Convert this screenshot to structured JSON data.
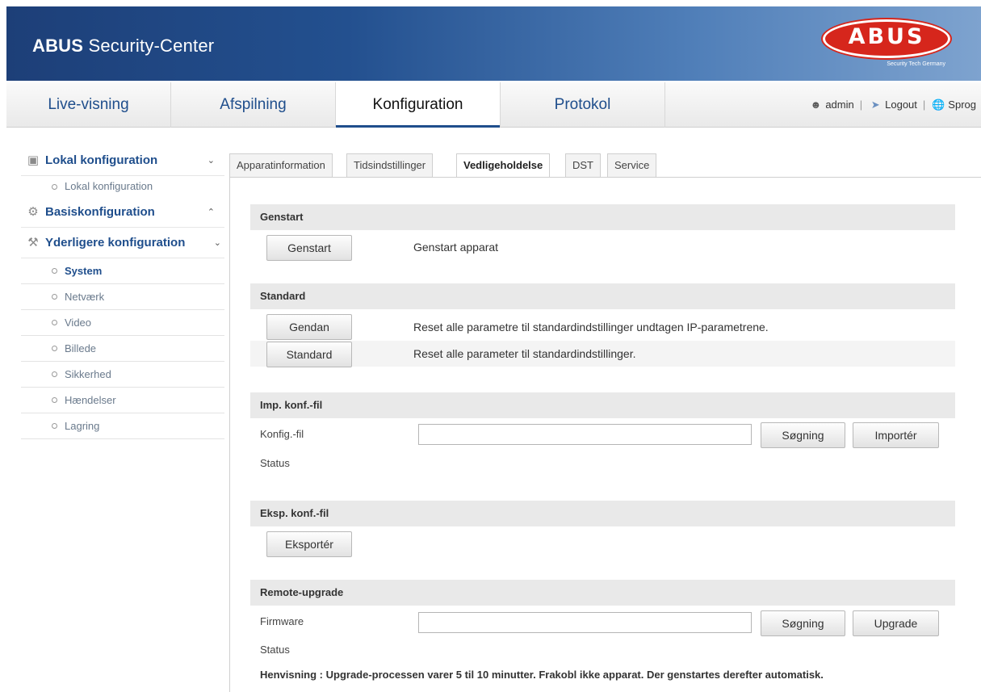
{
  "header": {
    "brand": "ABUS",
    "product": "Security-Center",
    "logo_text": "ABUS",
    "logo_tagline": "Security Tech Germany"
  },
  "nav": {
    "tabs": [
      {
        "label": "Live-visning"
      },
      {
        "label": "Afspilning"
      },
      {
        "label": "Konfiguration",
        "active": true
      },
      {
        "label": "Protokol"
      }
    ],
    "user": "admin",
    "logout": "Logout",
    "language": "Sprog"
  },
  "sidebar": {
    "local": {
      "label": "Lokal konfiguration",
      "items": [
        {
          "label": "Lokal konfiguration"
        }
      ]
    },
    "basic": {
      "label": "Basiskonfiguration"
    },
    "advanced": {
      "label": "Yderligere konfiguration",
      "items": [
        {
          "label": "System",
          "active": true
        },
        {
          "label": "Netværk"
        },
        {
          "label": "Video"
        },
        {
          "label": "Billede"
        },
        {
          "label": "Sikkerhed"
        },
        {
          "label": "Hændelser"
        },
        {
          "label": "Lagring"
        }
      ]
    }
  },
  "tabs": [
    {
      "label": "Apparatinformation"
    },
    {
      "label": "Tidsindstillinger"
    },
    {
      "label": "Vedligeholdelse",
      "active": true
    },
    {
      "label": "DST"
    },
    {
      "label": "Service"
    }
  ],
  "reboot": {
    "title": "Genstart",
    "button": "Genstart",
    "desc": "Genstart apparat"
  },
  "defaults": {
    "title": "Standard",
    "restore_button": "Gendan",
    "restore_desc": "Reset alle parametre til standardindstillinger undtagen IP-parametrene.",
    "default_button": "Standard",
    "default_desc": "Reset alle parameter til standardindstillinger."
  },
  "import_config": {
    "title": "Imp. konf.-fil",
    "file_label": "Konfig.-fil",
    "file_value": "",
    "browse_button": "Søgning",
    "import_button": "Importér",
    "status_label": "Status"
  },
  "export_config": {
    "title": "Eksp. konf.-fil",
    "export_button": "Eksportér"
  },
  "upgrade": {
    "title": "Remote-upgrade",
    "firmware_label": "Firmware",
    "firmware_value": "",
    "browse_button": "Søgning",
    "upgrade_button": "Upgrade",
    "status_label": "Status",
    "hint": "Henvisning : Upgrade-processen varer 5 til 10 minutter. Frakobl ikke apparat. Der genstartes derefter automatisk."
  },
  "icons": {
    "user": "user-icon",
    "logout": "logout-icon",
    "language": "globe-icon",
    "local": "monitor-icon",
    "basic": "gear-icon",
    "advanced": "wrench-icon"
  }
}
